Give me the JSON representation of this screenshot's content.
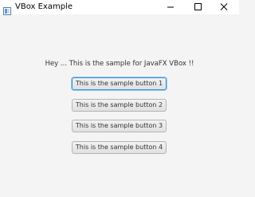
{
  "window": {
    "title": "VBox Example",
    "icon": "java-app-icon",
    "controls": {
      "minimize": "minimize-icon",
      "maximize": "maximize-icon",
      "close": "close-icon"
    }
  },
  "content": {
    "heading": "Hey ... This is the sample for JavaFX VBox !!",
    "buttons": [
      {
        "label": "This is the sample button 1",
        "focused": true
      },
      {
        "label": "This is the sample button 2",
        "focused": false
      },
      {
        "label": "This is the sample button 3",
        "focused": false
      },
      {
        "label": "This is the sample button 4",
        "focused": false
      }
    ]
  },
  "colors": {
    "background": "#f4f4f4",
    "focus_accent": "#2f8ed3"
  }
}
